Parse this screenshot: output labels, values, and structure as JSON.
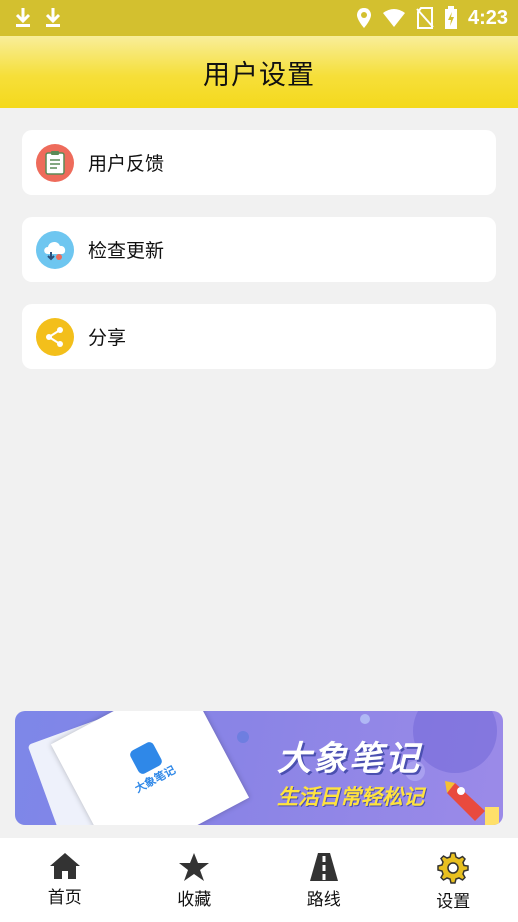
{
  "status_bar": {
    "time": "4:23",
    "icons": [
      "download-icon",
      "download-icon",
      "location-icon",
      "wifi-icon",
      "no-sim-icon",
      "battery-charging-icon"
    ]
  },
  "header": {
    "title": "用户设置"
  },
  "settings": [
    {
      "label": "用户反馈",
      "icon": "feedback-clipboard-icon",
      "icon_color": "#ee6b5b"
    },
    {
      "label": "检查更新",
      "icon": "cloud-download-icon",
      "icon_color": "#6ec6f0"
    },
    {
      "label": "分享",
      "icon": "share-icon",
      "icon_color": "#f3bf1b"
    }
  ],
  "banner": {
    "title": "大象笔记",
    "subtitle": "生活日常轻松记",
    "app_logo_text": "大象笔记"
  },
  "bottom_nav": [
    {
      "label": "首页",
      "icon": "home-icon"
    },
    {
      "label": "收藏",
      "icon": "star-icon"
    },
    {
      "label": "路线",
      "icon": "road-icon"
    },
    {
      "label": "设置",
      "icon": "gear-icon",
      "active": true
    }
  ],
  "colors": {
    "accent": "#f4d91c",
    "status_bar": "#d3c02f",
    "background": "#f1f1f1",
    "active_nav_icon": "#e8c020"
  }
}
